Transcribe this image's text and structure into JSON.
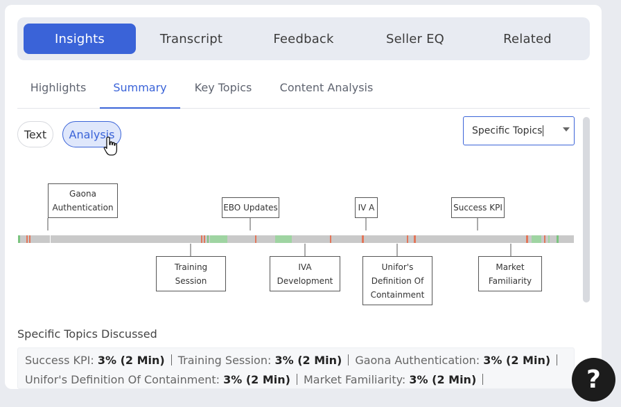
{
  "main_tabs": [
    {
      "label": "Insights",
      "active": true
    },
    {
      "label": "Transcript",
      "active": false
    },
    {
      "label": "Feedback",
      "active": false
    },
    {
      "label": "Seller EQ",
      "active": false
    },
    {
      "label": "Related",
      "active": false
    }
  ],
  "sub_tabs": [
    {
      "label": "Highlights",
      "active": false
    },
    {
      "label": "Summary",
      "active": true
    },
    {
      "label": "Key Topics",
      "active": false
    },
    {
      "label": "Content Analysis",
      "active": false
    }
  ],
  "view_toggle": {
    "text": "Text",
    "analysis": "Analysis",
    "selected": "Analysis"
  },
  "topic_filter": {
    "value": "Specific Topics"
  },
  "timeline": {
    "segment_colors": {
      "base": "#c9c9c9",
      "positive": "#7bc47f",
      "negative": "#e2765a",
      "neutral": "#9fd4a2"
    },
    "topics_above": [
      {
        "line1": "Gaona",
        "line2": "Authentication"
      },
      {
        "line1": "EBO Updates"
      },
      {
        "line1": "IV A"
      },
      {
        "line1": "Success KPI"
      }
    ],
    "topics_below": [
      {
        "line1": "Training",
        "line2": "Session"
      },
      {
        "line1": "IVA",
        "line2": "Development"
      },
      {
        "line1": "Unifor's",
        "line2": "Definition Of",
        "line3": "Containment"
      },
      {
        "line1": "Market",
        "line2": "Familiarity"
      }
    ]
  },
  "summary": {
    "title": "Specific Topics Discussed",
    "stats": [
      {
        "name": "Success KPI:",
        "value": "3% (2 Min)"
      },
      {
        "name": "Training Session:",
        "value": "3% (2 Min)"
      },
      {
        "name": "Gaona Authentication:",
        "value": "3% (2 Min)"
      }
    ],
    "stats_row2": [
      {
        "name": "Unifor's Definition Of Containment:",
        "value": "3% (2 Min)"
      },
      {
        "name": "Market Familiarity:",
        "value": "3% (2 Min)"
      }
    ]
  },
  "help": {
    "label": "?"
  }
}
